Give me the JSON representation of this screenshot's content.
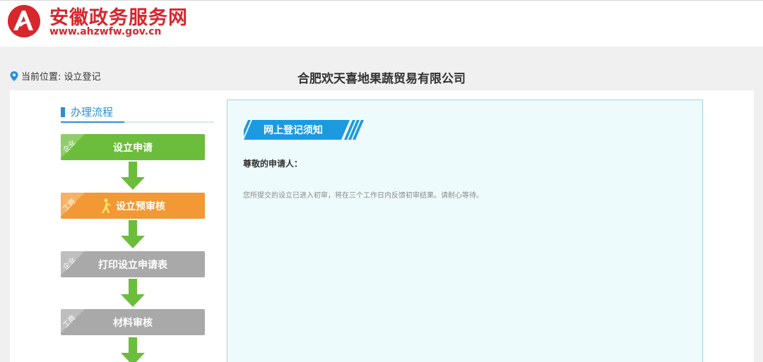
{
  "header": {
    "site_name": "安徽政务服务网",
    "site_url": "www.ahzwfw.gov.cn",
    "logo_icon": "ahzwfw-logo-icon",
    "brand_color": "#d7262c"
  },
  "location": {
    "icon": "map-pin-icon",
    "text": "当前位置: 设立登记"
  },
  "company_name": "合肥欢天喜地果蔬贸易有限公司",
  "flow": {
    "title": "办理流程",
    "steps": [
      {
        "tag": "企业",
        "label": "设立申请",
        "status": "done",
        "color": "#6bbd3b"
      },
      {
        "tag": "工商",
        "label": "设立预审核",
        "status": "current",
        "color": "#f29835",
        "icon": "walking-person-icon"
      },
      {
        "tag": "企业",
        "label": "打印设立申请表",
        "status": "pending",
        "color": "#a9a9a9"
      },
      {
        "tag": "工商",
        "label": "材料审核",
        "status": "pending",
        "color": "#a9a9a9"
      }
    ],
    "arrow_color": "#6bbd3b"
  },
  "notice": {
    "title": "网上登记须知",
    "greeting": "尊敬的申请人：",
    "message": "您所提交的设立已进入初审，将在三个工作日内反馈初审结果。请耐心等待。"
  }
}
